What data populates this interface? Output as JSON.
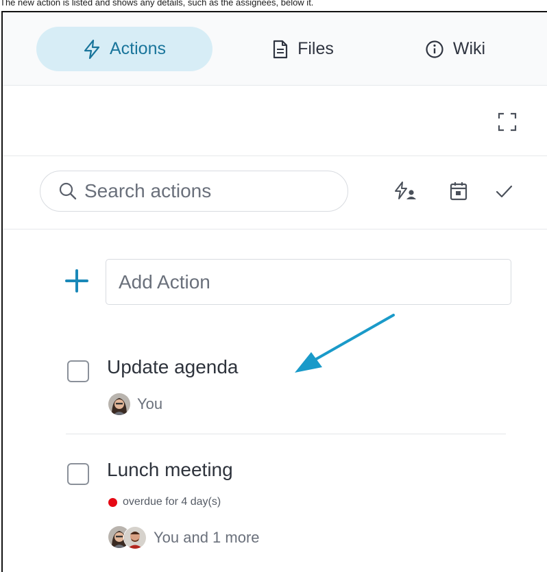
{
  "caption": "The new action is listed and shows any details, such as the assignees, below it.",
  "tabs": [
    {
      "label": "Actions",
      "icon": "bolt-icon",
      "active": true
    },
    {
      "label": "Files",
      "icon": "file-icon",
      "active": false
    },
    {
      "label": "Wiki",
      "icon": "info-icon",
      "active": false
    }
  ],
  "search": {
    "placeholder": "Search actions"
  },
  "add_action": {
    "placeholder": "Add Action"
  },
  "actions": [
    {
      "title": "Update agenda",
      "assignee": "You"
    },
    {
      "title": "Lunch meeting",
      "status": "overdue for 4 day(s)",
      "assignee": "You and 1 more"
    }
  ],
  "colors": {
    "accent": "#1a88b8",
    "active_tab_bg": "#d7edf6",
    "overdue": "#e50914",
    "annotation_arrow": "#1a9ac9"
  }
}
